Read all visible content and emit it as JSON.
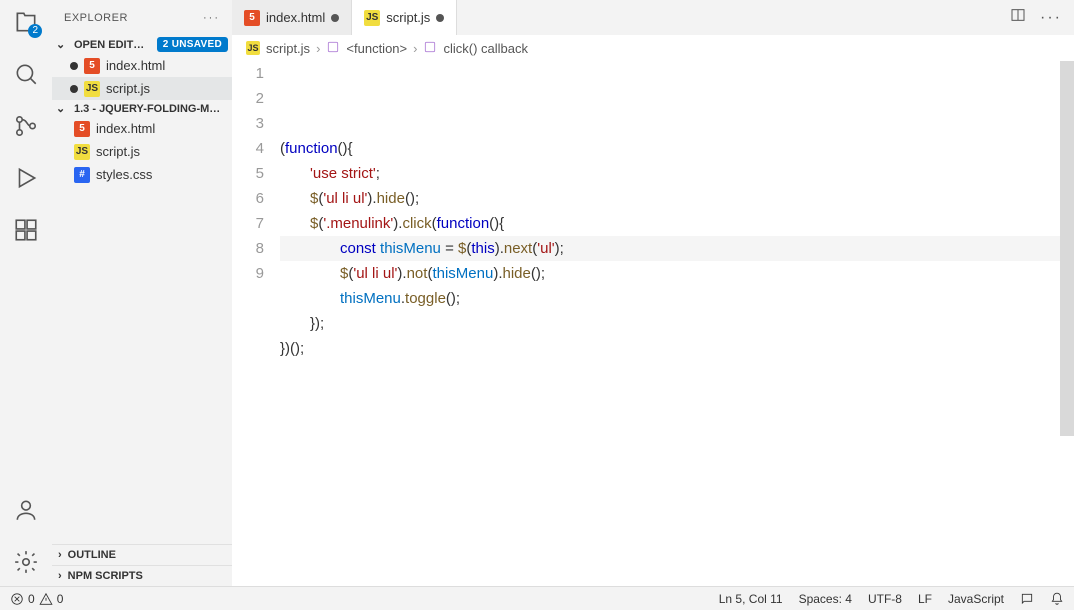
{
  "sidebar": {
    "title": "EXPLORER",
    "openEditors": {
      "label": "OPEN EDIT…",
      "badge": "2 UNSAVED"
    },
    "editors": [
      {
        "name": "index.html",
        "type": "html",
        "modified": true
      },
      {
        "name": "script.js",
        "type": "js",
        "modified": true,
        "active": true
      }
    ],
    "folder": {
      "label": "1.3 - JQUERY-FOLDING-M…"
    },
    "files": [
      {
        "name": "index.html",
        "type": "html"
      },
      {
        "name": "script.js",
        "type": "js"
      },
      {
        "name": "styles.css",
        "type": "css"
      }
    ],
    "outline": "OUTLINE",
    "npm": "NPM SCRIPTS"
  },
  "tabs": [
    {
      "name": "index.html",
      "type": "html",
      "modified": true
    },
    {
      "name": "script.js",
      "type": "js",
      "modified": true,
      "active": true
    }
  ],
  "breadcrumbs": {
    "file": "script.js",
    "fn": "<function>",
    "cb": "click() callback"
  },
  "code": {
    "lines": [
      [
        {
          "t": "(",
          "c": "punc"
        },
        {
          "t": "function",
          "c": "kw"
        },
        {
          "t": "(){",
          "c": "punc"
        }
      ],
      [
        {
          "indent": 1
        },
        {
          "t": "'use strict'",
          "c": "str"
        },
        {
          "t": ";",
          "c": "punc"
        }
      ],
      [
        {
          "indent": 1
        },
        {
          "t": "$",
          "c": "fn"
        },
        {
          "t": "(",
          "c": "punc"
        },
        {
          "t": "'ul li ul'",
          "c": "str"
        },
        {
          "t": ").",
          "c": "punc"
        },
        {
          "t": "hide",
          "c": "fn"
        },
        {
          "t": "();",
          "c": "punc"
        }
      ],
      [
        {
          "indent": 1
        },
        {
          "t": "$",
          "c": "fn"
        },
        {
          "t": "(",
          "c": "punc"
        },
        {
          "t": "'.menulink'",
          "c": "str"
        },
        {
          "t": ").",
          "c": "punc"
        },
        {
          "t": "click",
          "c": "fn"
        },
        {
          "t": "(",
          "c": "punc"
        },
        {
          "t": "function",
          "c": "kw"
        },
        {
          "t": "(){",
          "c": "punc"
        }
      ],
      [
        {
          "indent": 2,
          "hl": true
        },
        {
          "t": "const ",
          "c": "kw"
        },
        {
          "t": "thisMenu",
          "c": "var"
        },
        {
          "t": " = ",
          "c": "punc"
        },
        {
          "t": "$",
          "c": "fn"
        },
        {
          "t": "(",
          "c": "punc"
        },
        {
          "t": "this",
          "c": "this"
        },
        {
          "t": ").",
          "c": "punc"
        },
        {
          "t": "next",
          "c": "fn"
        },
        {
          "t": "(",
          "c": "punc"
        },
        {
          "t": "'ul'",
          "c": "str"
        },
        {
          "t": ");",
          "c": "punc"
        }
      ],
      [
        {
          "indent": 2
        },
        {
          "t": "$",
          "c": "fn"
        },
        {
          "t": "(",
          "c": "punc"
        },
        {
          "t": "'ul li ul'",
          "c": "str"
        },
        {
          "t": ").",
          "c": "punc"
        },
        {
          "t": "not",
          "c": "fn"
        },
        {
          "t": "(",
          "c": "punc"
        },
        {
          "t": "thisMenu",
          "c": "var"
        },
        {
          "t": ").",
          "c": "punc"
        },
        {
          "t": "hide",
          "c": "fn"
        },
        {
          "t": "();",
          "c": "punc"
        }
      ],
      [
        {
          "indent": 2
        },
        {
          "t": "thisMenu",
          "c": "var"
        },
        {
          "t": ".",
          "c": "punc"
        },
        {
          "t": "toggle",
          "c": "fn"
        },
        {
          "t": "();",
          "c": "punc"
        }
      ],
      [
        {
          "indent": 1
        },
        {
          "t": "});",
          "c": "punc"
        }
      ],
      [
        {
          "t": "})();",
          "c": "punc"
        }
      ]
    ]
  },
  "status": {
    "errors": "0",
    "warnings": "0",
    "lncol": "Ln 5, Col 11",
    "spaces": "Spaces: 4",
    "enc": "UTF-8",
    "eol": "LF",
    "lang": "JavaScript"
  },
  "activity": {
    "explorer_badge": "2"
  }
}
